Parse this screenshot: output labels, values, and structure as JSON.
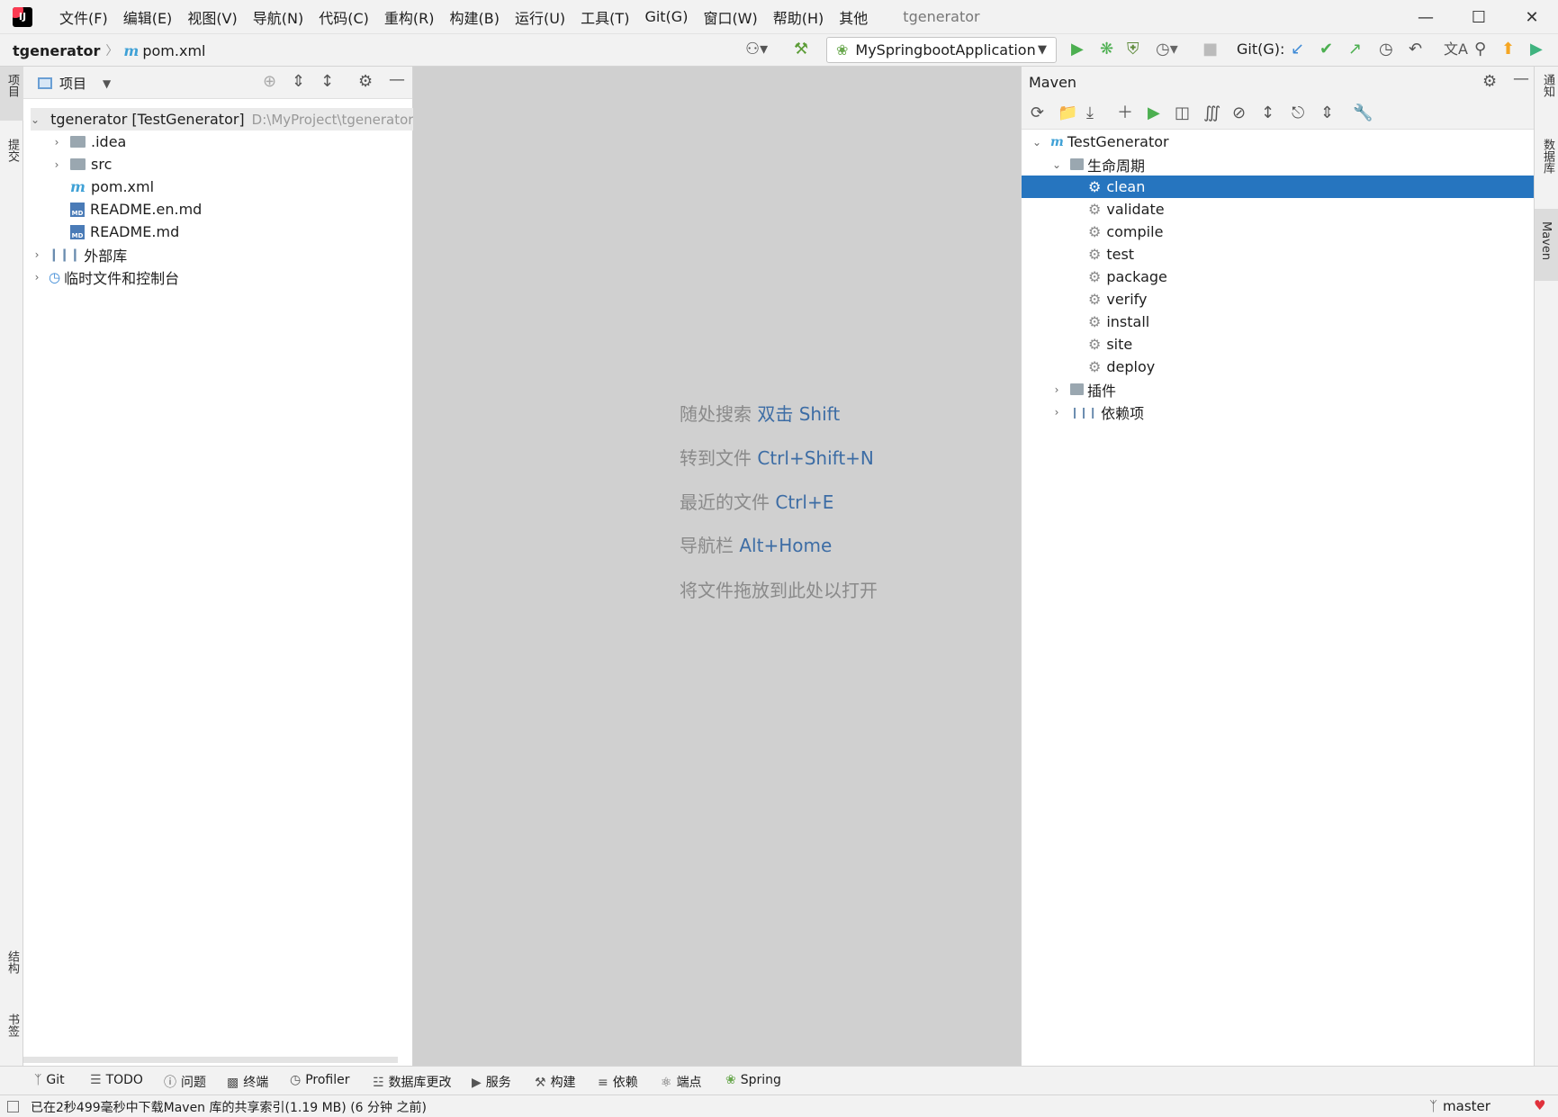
{
  "menu": {
    "items": [
      "文件(F)",
      "编辑(E)",
      "视图(V)",
      "导航(N)",
      "代码(C)",
      "重构(R)",
      "构建(B)",
      "运行(U)",
      "工具(T)",
      "Git(G)",
      "窗口(W)",
      "帮助(H)",
      "其他"
    ],
    "window_title": "tgenerator"
  },
  "navbar": {
    "project": "tgenerator",
    "file": "pom.xml",
    "run_config": "MySpringbootApplication",
    "git_label": "Git(G):"
  },
  "left_stripe": {
    "project_tab": "项目",
    "commit_tab": "提交",
    "structure_tab": "结构",
    "bookmarks_tab": "书签"
  },
  "project_panel": {
    "title": "项目",
    "root_name": "tgenerator [TestGenerator]",
    "root_path": "D:\\MyProject\\tgenerator",
    "items": [
      ".idea",
      "src",
      "pom.xml",
      "README.en.md",
      "README.md"
    ],
    "external_libs": "外部库",
    "scratches": "临时文件和控制台"
  },
  "editor_hints": [
    {
      "text": "随处搜索",
      "key": "双击 Shift"
    },
    {
      "text": "转到文件",
      "key": "Ctrl+Shift+N"
    },
    {
      "text": "最近的文件",
      "key": "Ctrl+E"
    },
    {
      "text": "导航栏",
      "key": "Alt+Home"
    },
    {
      "text": "将文件拖放到此处以打开",
      "key": ""
    }
  ],
  "maven": {
    "title": "Maven",
    "project": "TestGenerator",
    "lifecycle": "生命周期",
    "phases": [
      "clean",
      "validate",
      "compile",
      "test",
      "package",
      "verify",
      "install",
      "site",
      "deploy"
    ],
    "selected_phase": "clean",
    "plugins": "插件",
    "dependencies": "依赖项"
  },
  "right_stripe": {
    "notifications_tab": "通知",
    "database_tab": "数据库",
    "maven_tab": "Maven"
  },
  "tool_tabs": [
    "Git",
    "TODO",
    "问题",
    "终端",
    "Profiler",
    "数据库更改",
    "服务",
    "构建",
    "依赖",
    "端点",
    "Spring"
  ],
  "status": {
    "message": "已在2秒499毫秒中下载Maven 库的共享索引(1.19 MB) (6 分钟 之前)",
    "branch": "master"
  },
  "colors": {
    "selection": "#2675bf",
    "run_green": "#4caf50",
    "link_blue": "#3d6da5"
  }
}
